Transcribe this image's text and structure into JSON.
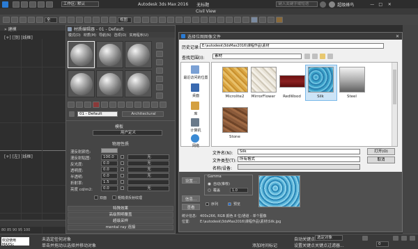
{
  "titlebar": {
    "workspace": "工作区: 默认",
    "title": "Autodesk 3ds Max 2016",
    "doc": "无标题",
    "search_placeholder": "键入关键字或短语",
    "user": "超级蜂鸟"
  },
  "menubar": {
    "items": [
      "Civil View"
    ]
  },
  "toolbar": {
    "view_select": "视图"
  },
  "viewport": {
    "label_top": "[+] [顶] [线框]",
    "label_left": "[+] [左] [线框]",
    "ruler": "80  85  90  95  100"
  },
  "material_editor": {
    "title": "材质编辑器 - 01 - Default",
    "menu": [
      "模式(D)",
      "材质(M)",
      "导航(N)",
      "选项(O)",
      "实用程序(U)"
    ],
    "material_name": "01 - Default",
    "material_type": "Architectural",
    "rollouts": {
      "templates": "模板",
      "template_value": "用户定义",
      "physical": "物理性质",
      "special_effects": "特殊效果",
      "advanced_lighting": "高级照明覆盖",
      "supersampling": "超级采样",
      "mental_ray": "mental ray 连接"
    },
    "props": [
      {
        "label": "漫反射颜色:",
        "value": "",
        "unit": ""
      },
      {
        "label": "漫反射贴图:",
        "value": "100.0",
        "unit": "无"
      },
      {
        "label": "反光度:",
        "value": "0.0",
        "unit": "无"
      },
      {
        "label": "透明度:",
        "value": "0.0",
        "unit": "无"
      },
      {
        "label": "半透明:",
        "value": "0.0",
        "unit": "无"
      },
      {
        "label": "折射率:",
        "value": "1.5",
        "unit": ""
      },
      {
        "label": "亮度 cd/m2:",
        "value": "0.0",
        "unit": "无"
      }
    ],
    "checks": {
      "twosided": "双面",
      "raw_diffuse": "粗糙漫反射纹理"
    }
  },
  "file_dialog": {
    "title": "选择位图图像文件",
    "history_label": "历史记录:",
    "history_value": "E:\\autodesk\\3dsMax2016\\课程作品\\素材",
    "lookin_label": "查找范围(I):",
    "lookin_value": "素材",
    "places": [
      "最近访问的位置",
      "桌面",
      "库",
      "计算机",
      "网络"
    ],
    "files": [
      {
        "name": "Microlite2"
      },
      {
        "name": "MirrorFlower"
      },
      {
        "name": "RedWood"
      },
      {
        "name": "Silk"
      },
      {
        "name": "Steel"
      },
      {
        "name": "Stone"
      }
    ],
    "filename_label": "文件名(N):",
    "filename_value": "Silk",
    "filetype_label": "文件类型(T):",
    "filetype_value": "所有格式",
    "open_button": "打开(O)",
    "cancel_button": "取消",
    "devices_label": "名称/设备:",
    "gamma_title": "Gamma",
    "gamma_auto": "自动(推荐)",
    "gamma_override": "覆盖",
    "gamma_value": "1.0",
    "setup_button": "设置...",
    "info_button": "信息...",
    "view_button": "查看",
    "sequence": "序列",
    "preview": "预览",
    "stats_label": "统计信息:",
    "stats_value": "400x266, RGB 颜色 8 位/通道 - 单个图像",
    "location_label": "位置:",
    "location_value": "E:\\autodesk\\3dsMax2016\\课程作品\\素材\\Silk.jpg"
  },
  "statusbar": {
    "welcome": "欢迎使用 MAXSc",
    "status1": "未选定任何对象",
    "status2": "单击并拖动以选择并移动对象",
    "add_time_tag": "添加时间标记",
    "autokey": "自动关键点",
    "selection": "选定对象",
    "setkey": "设置关键点",
    "keyfilter": "关键点过滤器...",
    "frame": "0",
    "track_range": "0 / 100"
  },
  "colors": {
    "accent": "#2a6fc9",
    "dialog_bg": "#f0f0f0"
  }
}
